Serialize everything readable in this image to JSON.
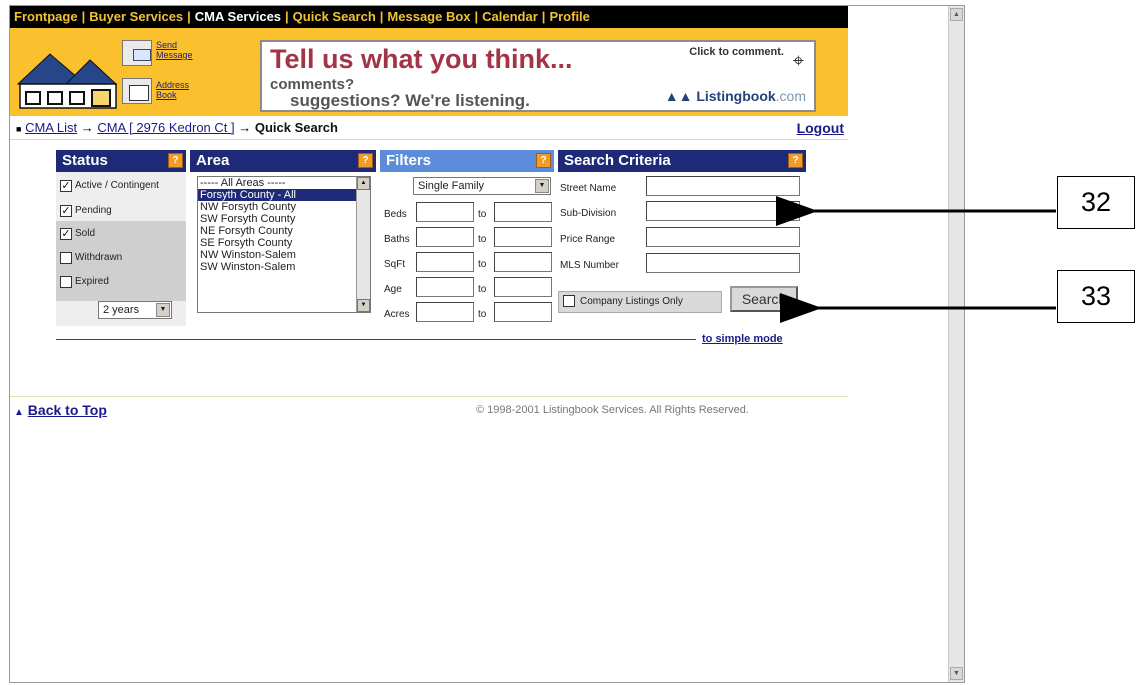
{
  "nav": {
    "items": [
      "Frontpage",
      "Buyer Services",
      "CMA Services",
      "Quick Search",
      "Message Box",
      "Calendar",
      "Profile"
    ],
    "separator": "|"
  },
  "banner": {
    "send_message": "Send Message",
    "address_book": "Address Book",
    "ad_headline": "Tell us what you think...",
    "ad_line2": "comments?",
    "ad_line3": "suggestions?  We're listening.",
    "ad_click": "Click to comment.",
    "ad_brand": "Listingbook",
    "ad_brand_suffix": ".com"
  },
  "breadcrumb": {
    "bullet": "■",
    "cma_list": "CMA List",
    "arrow": "→",
    "cma": "CMA [ 2976 Kedron Ct ]",
    "current": "Quick Search",
    "logout": "Logout"
  },
  "status": {
    "title": "Status",
    "help": "?",
    "options": [
      {
        "label": "Active / Contingent",
        "checked": "✓"
      },
      {
        "label": "Pending",
        "checked": "✓"
      },
      {
        "label": "Sold",
        "checked": "✓"
      },
      {
        "label": "Withdrawn",
        "checked": ""
      },
      {
        "label": "Expired",
        "checked": ""
      }
    ],
    "period": "2 years"
  },
  "area": {
    "title": "Area",
    "help": "?",
    "options": [
      "----- All Areas -----",
      "Forsyth County - All",
      "NW Forsyth County",
      "SW Forsyth County",
      "NE Forsyth County",
      "SE Forsyth County",
      "NW Winston-Salem",
      "SW Winston-Salem"
    ],
    "selected_index": 1
  },
  "filters": {
    "title": "Filters",
    "help": "?",
    "property_type": "Single Family",
    "rows": [
      "Beds",
      "Baths",
      "SqFt",
      "Age",
      "Acres"
    ],
    "to": "to"
  },
  "criteria": {
    "title": "Search Criteria",
    "help": "?",
    "fields": [
      "Street Name",
      "Sub-Division",
      "Price Range",
      "MLS Number"
    ],
    "company_only": "Company Listings Only",
    "search_button": "Search",
    "simple_mode": "to simple mode"
  },
  "footer": {
    "back_to_top": "Back to Top",
    "copyright": "© 1998-2001 Listingbook Services. All Rights Reserved."
  },
  "callouts": {
    "subdivision": "32",
    "search": "33"
  }
}
